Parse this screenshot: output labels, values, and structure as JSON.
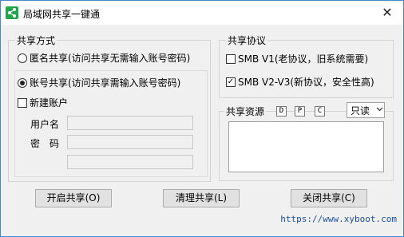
{
  "window": {
    "title": "局域网共享一键通",
    "close_glyph": "✕"
  },
  "share_mode": {
    "title": "共享方式",
    "anonymous_label": "匿名共享(访问共享无需输入账号密码)",
    "account_label": "账号共享(访问共享需输入账号密码)",
    "selected": "account",
    "new_account_label": "新建账户",
    "new_account_checked": false,
    "username_label": "用户名",
    "password_label": "密　码",
    "username_value": "",
    "password_value": "",
    "confirm_value": ""
  },
  "protocol": {
    "title": "共享协议",
    "smb1_label": "SMB V1(老协议，旧系统需要)",
    "smb1_checked": false,
    "smb2_label": "SMB V2-V3(新协议，安全性高)",
    "smb2_checked": true
  },
  "resources": {
    "title": "共享资源",
    "d_button": "D",
    "p_button": "P",
    "c_button": "C",
    "permission": "只读",
    "chevron": "⌄",
    "list_value": ""
  },
  "actions": {
    "start": "开启共享(O)",
    "clean": "清理共享(L)",
    "stop": "关闭共享(C)"
  },
  "footer": {
    "url": "https://www.xyboot.com"
  },
  "colors": {
    "accent": "#1fa84a",
    "link": "#1a4fa0",
    "border": "#4a86c8"
  },
  "icons": {
    "app": "share-icon",
    "close": "close-icon",
    "dropdown": "chevron-down-icon"
  }
}
